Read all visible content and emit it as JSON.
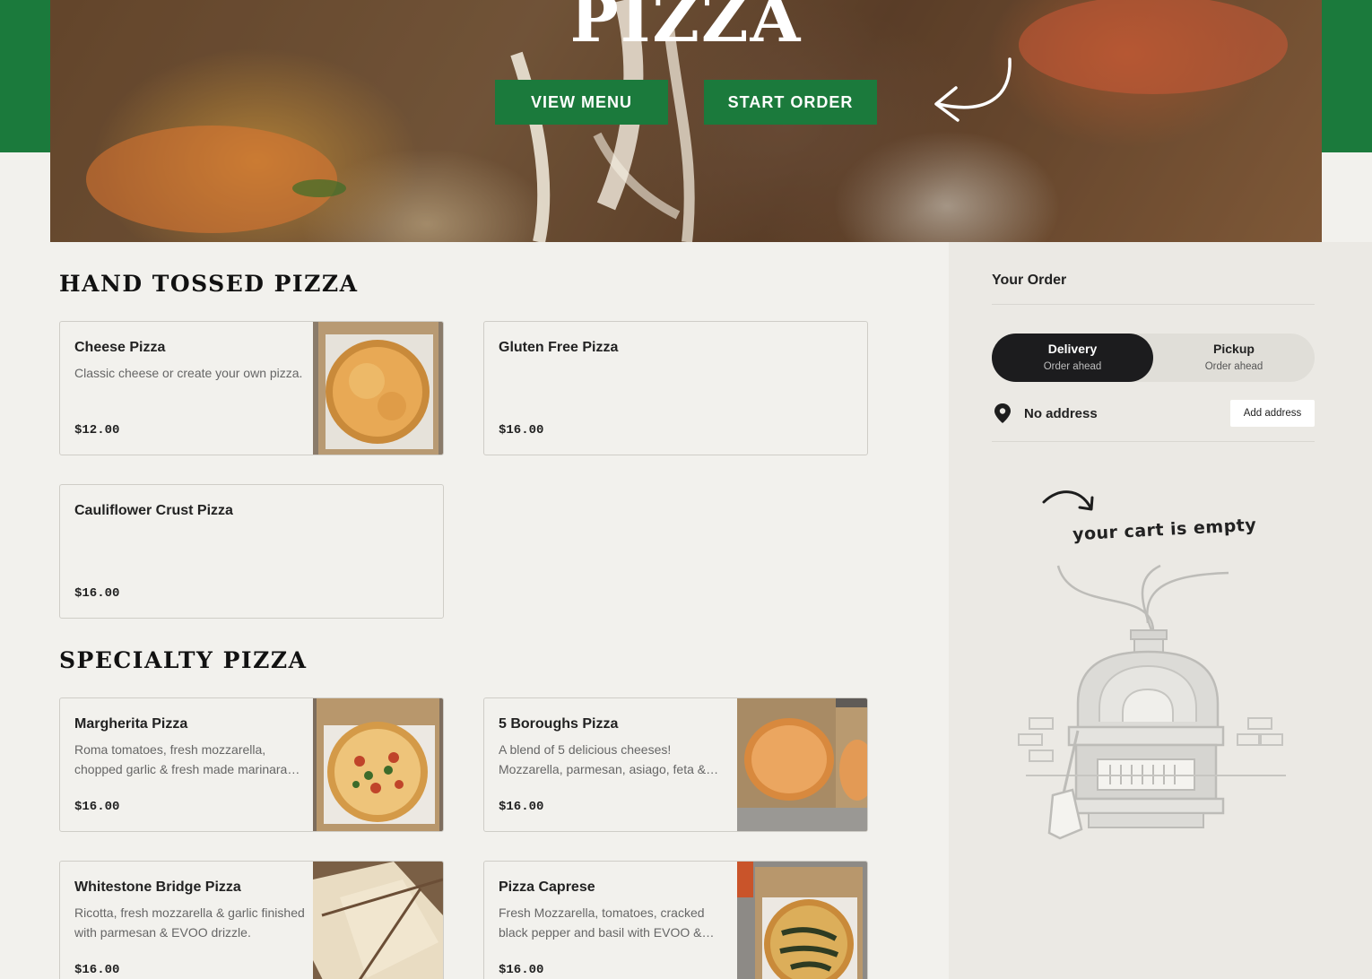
{
  "hero": {
    "title": "PIZZA",
    "view_menu_label": "VIEW MENU",
    "start_order_label": "START ORDER"
  },
  "sections": [
    {
      "title": "HAND TOSSED PIZZA",
      "items": [
        {
          "name": "Cheese Pizza",
          "description": "Classic cheese or create your own pizza.",
          "price": "$12.00"
        },
        {
          "name": "Gluten Free Pizza",
          "description": "",
          "price": "$16.00"
        },
        {
          "name": "Cauliflower Crust Pizza",
          "description": "",
          "price": "$16.00"
        }
      ]
    },
    {
      "title": "SPECIALTY PIZZA",
      "items": [
        {
          "name": "Margherita Pizza",
          "description": "Roma tomatoes, fresh mozzarella, chopped garlic & fresh made marinara sauce.",
          "price": "$16.00"
        },
        {
          "name": "5 Boroughs Pizza",
          "description": "A blend of 5 delicious cheeses! Mozzarella, parmesan, asiago, feta & ricotta.",
          "price": "$16.00"
        },
        {
          "name": "Whitestone Bridge Pizza",
          "description": "Ricotta, fresh mozzarella & garlic finished with parmesan & EVOO drizzle.",
          "price": "$16.00"
        },
        {
          "name": "Pizza Caprese",
          "description": "Fresh Mozzarella, tomatoes, cracked black pepper and basil with EVOO & balsamic.",
          "price": "$16.00"
        }
      ]
    }
  ],
  "order": {
    "title": "Your Order",
    "delivery_label": "Delivery",
    "delivery_sub": "Order ahead",
    "pickup_label": "Pickup",
    "pickup_sub": "Order ahead",
    "address_label": "No address",
    "add_address_label": "Add address",
    "empty_cart_text": "your cart is empty"
  },
  "colors": {
    "brand_green": "#1b7a3c",
    "background": "#f2f1ed",
    "sidebar": "#ebe9e4",
    "toggle_active": "#1c1c1e"
  }
}
